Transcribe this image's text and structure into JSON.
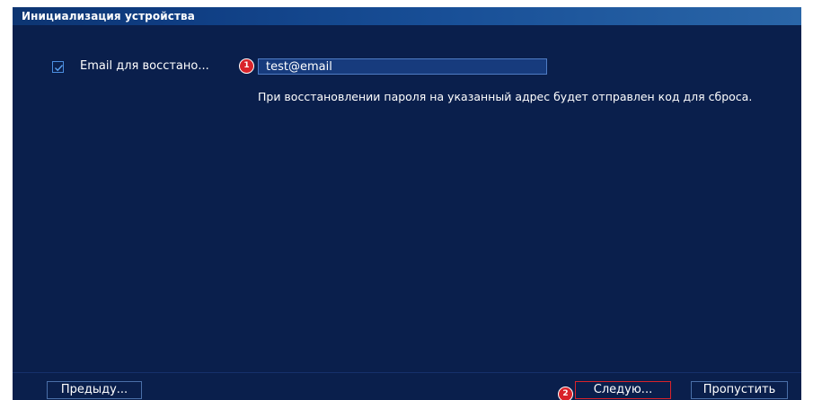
{
  "window": {
    "title": "Инициализация устройства"
  },
  "email_section": {
    "checkbox_checked": true,
    "label": "Email для восстано...",
    "input_value": "test@email",
    "hint": "При восстановлении пароля на указанный адрес будет отправлен код для сброса."
  },
  "annotations": {
    "marker1": "1",
    "marker2": "2"
  },
  "buttons": {
    "prev": "Предыду...",
    "next": "Следую...",
    "skip": "Пропустить"
  },
  "colors": {
    "background": "#0a1f4c",
    "titlebar": "#184f97",
    "input_bg": "#173b7d",
    "accent_red": "#d9232a",
    "button_border": "#4a6fa8"
  },
  "icons": {
    "checkbox": "checkmark-icon"
  }
}
